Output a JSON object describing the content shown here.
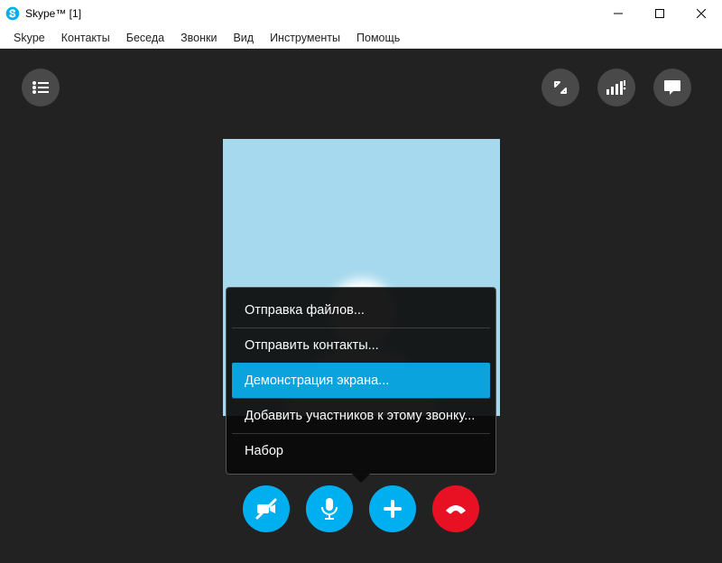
{
  "window": {
    "title": "Skype™ [1]"
  },
  "menu": {
    "items": [
      "Skype",
      "Контакты",
      "Беседа",
      "Звонки",
      "Вид",
      "Инструменты",
      "Помощь"
    ]
  },
  "popup": {
    "items": [
      {
        "label": "Отправка файлов...",
        "selected": false
      },
      {
        "label": "Отправить контакты...",
        "selected": false
      },
      {
        "label": "Демонстрация экрана...",
        "selected": true
      },
      {
        "label": "Добавить участников к этому звонку...",
        "selected": false
      },
      {
        "label": "Набор",
        "selected": false
      }
    ]
  },
  "colors": {
    "accent": "#00aff0",
    "hangup": "#e81123"
  }
}
